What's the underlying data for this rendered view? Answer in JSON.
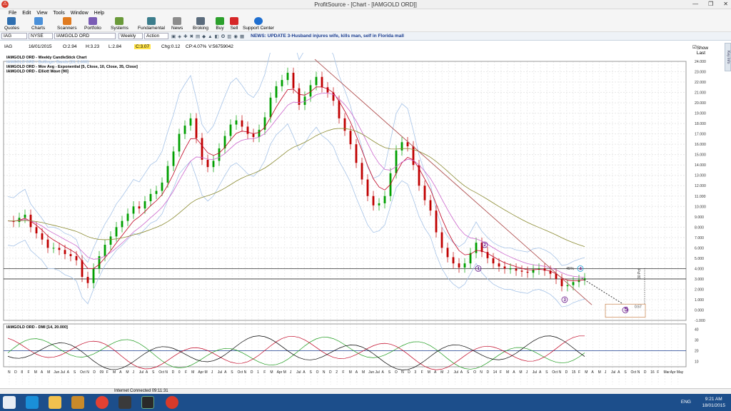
{
  "window": {
    "title": "ProfitSource - [Chart - [IAMGOLD ORD]]"
  },
  "menu": [
    "File",
    "Edit",
    "View",
    "Tools",
    "Window",
    "Help"
  ],
  "toolbar": [
    "Quotes",
    "Charts",
    "Scanners",
    "Portfolio",
    "Systems",
    "Fundamental",
    "News",
    "Broking",
    "Buy",
    "Sell",
    "Support Center"
  ],
  "subbar": {
    "symbol": "IAG",
    "exchange": "NYSE",
    "name": "IAMGOLD ORD",
    "period": "Weekly",
    "action": "Action",
    "news": "NEWS: UPDATE 3-Husband injures wife, kills man, self in Florida mall"
  },
  "quote": {
    "sym": "IAG",
    "date": "16/01/2015",
    "open": "O:2.94",
    "high": "H:3.23",
    "low": "L:2.84",
    "close": "C:3.07",
    "chg": "Chg:0.12",
    "cp": "CP:4.07%",
    "vol": "V:56759042",
    "show_last": "Show Last"
  },
  "legend": [
    "IAMGOLD ORD - Weekly CandleStick Chart",
    "IAMGOLD ORD - Bollinger Bands [20, 2.000]",
    "IAMGOLD ORD - Mov Avg - Exponential [5, Close, 10, Close, 35, Close]",
    "IAMGOLD ORD - Elliott Wave [90]"
  ],
  "dmi_label": "IAMGOLD ORD - DMI [14, 20.000]",
  "chart_data": {
    "type": "line",
    "title": "IAMGOLD ORD - Weekly CandleStick Chart",
    "y_ticks": [
      "24.000",
      "23.000",
      "22.000",
      "21.000",
      "20.000",
      "19.000",
      "18.000",
      "17.000",
      "16.000",
      "15.000",
      "14.000",
      "13.000",
      "12.000",
      "11.000",
      "10.000",
      "9.000",
      "8.000",
      "7.000",
      "6.000",
      "5.000",
      "4.000",
      "3.000",
      "2.000",
      "1.000",
      "0.000",
      "-1.000"
    ],
    "ylim": [
      -1,
      24
    ],
    "dmi_ticks": [
      "40",
      "30",
      "20",
      "10"
    ],
    "x_labels": [
      "N",
      "D",
      "8",
      "F",
      "M",
      "A",
      "M",
      "Jun",
      "Jul",
      "A",
      "S",
      "Oct",
      "N",
      "D",
      "09",
      "F",
      "M",
      "A",
      "M",
      "J",
      "Jul",
      "A",
      "S",
      "Oct",
      "N",
      "D",
      "0",
      "F",
      "M",
      "Apr",
      "M",
      "J",
      "Jul",
      "A",
      "S",
      "Oct",
      "N",
      "D",
      "1",
      "F",
      "M",
      "Apr",
      "M",
      "J",
      "Jul",
      "A",
      "S",
      "O",
      "N",
      "D",
      "2",
      "F",
      "M",
      "A",
      "M",
      "Jun",
      "Jul",
      "A",
      "S",
      "O",
      "N",
      "D",
      "3",
      "F",
      "M",
      "A",
      "M",
      "J",
      "Jul",
      "A",
      "S",
      "O",
      "N",
      "D",
      "14",
      "F",
      "M",
      "A",
      "M",
      "J",
      "Jul",
      "A",
      "S",
      "Oct",
      "N",
      "D",
      "15",
      "F",
      "M",
      "A",
      "M",
      "J",
      "Jul",
      "A",
      "S",
      "Oct",
      "N",
      "D",
      "16",
      "F",
      "Mar",
      "Apr",
      "May"
    ],
    "price_path": [
      8.6,
      8.5,
      8.9,
      9.2,
      8.0,
      7.4,
      6.8,
      6.0,
      6.0,
      5.8,
      5.4,
      5.2,
      4.8,
      3.2,
      2.6,
      4.0,
      5.2,
      6.3,
      7.1,
      8.0,
      8.6,
      9.3,
      10.0,
      9.8,
      10.5,
      11.2,
      11.5,
      12.3,
      13.9,
      15.3,
      17.0,
      17.8,
      18.5,
      16.6,
      14.5,
      13.8,
      14.4,
      15.6,
      16.8,
      17.9,
      18.3,
      17.7,
      17.0,
      16.7,
      17.4,
      18.6,
      20.5,
      21.6,
      22.2,
      22.9,
      21.4,
      19.8,
      20.6,
      21.7,
      22.5,
      21.5,
      21.0,
      20.2,
      18.5,
      17.3,
      16.0,
      14.2,
      12.6,
      11.0,
      10.1,
      10.3,
      11.0,
      13.2,
      15.4,
      16.2,
      15.8,
      14.0,
      12.0,
      10.6,
      9.6,
      7.5,
      6.0,
      5.1,
      4.5,
      4.1,
      4.5,
      5.5,
      6.5,
      5.6,
      5.0,
      4.5,
      4.2,
      4.0,
      4.0,
      3.8,
      3.7,
      3.6,
      3.9,
      4.0,
      3.8,
      3.5,
      3.0,
      2.3,
      2.4,
      2.7,
      2.9,
      3.07
    ],
    "annotations": {
      "wave_labels": [
        "1",
        "2",
        "3",
        "4",
        "5"
      ],
      "pct": "45%",
      "retrace": "0.57",
      "pct30": "30 Pct",
      "five": "5"
    }
  },
  "status": {
    "conn": "Internet Connected 09:11:31"
  },
  "tray": {
    "lang": "ENG",
    "time": "9:21 AM",
    "date": "18/01/2015"
  },
  "colors": {
    "accent": "#1c4e8b",
    "candle_up": "#00a000",
    "candle_dn": "#c00000",
    "ema5": "#c00020",
    "ema10": "#cc66cc",
    "ema35": "#8a8a30",
    "bb": "#a7c4e8"
  }
}
